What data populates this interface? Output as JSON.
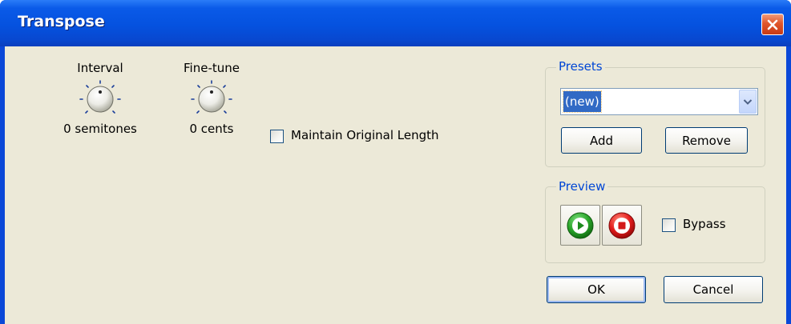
{
  "window": {
    "title": "Transpose",
    "close_icon": "close-icon"
  },
  "controls": {
    "interval": {
      "label": "Interval",
      "value_text": "0 semitones",
      "icon": "knob-icon"
    },
    "finetune": {
      "label": "Fine-tune",
      "value_text": "0 cents",
      "icon": "knob-icon"
    },
    "maintain_length": {
      "label": "Maintain Original Length",
      "checked": false
    }
  },
  "presets": {
    "legend": "Presets",
    "selected": "(new)",
    "add_label": "Add",
    "remove_label": "Remove"
  },
  "preview": {
    "legend": "Preview",
    "play_icon": "play-icon",
    "stop_icon": "stop-icon",
    "bypass_label": "Bypass",
    "bypass_checked": false
  },
  "buttons": {
    "ok_label": "OK",
    "cancel_label": "Cancel"
  },
  "colors": {
    "title_bar": "#0552df",
    "dialog_face": "#ece9d8",
    "group_label": "#0046d5",
    "close_button": "#e0562b",
    "play": "#2aa52a",
    "stop": "#e31c1c"
  }
}
